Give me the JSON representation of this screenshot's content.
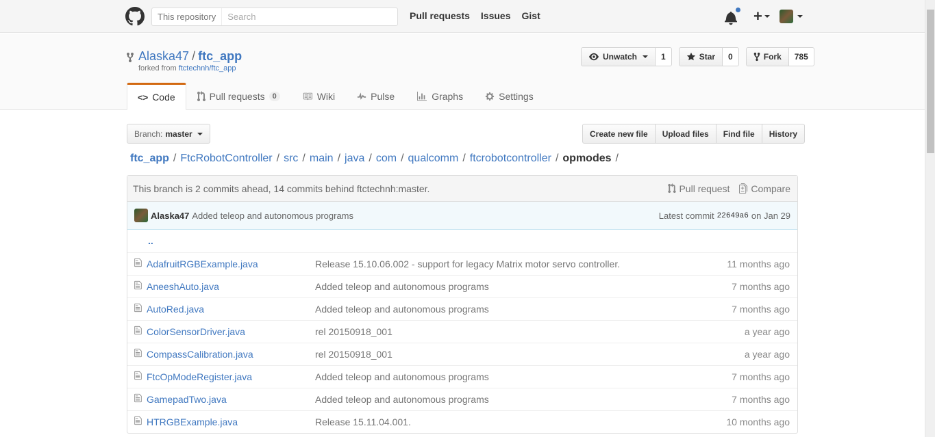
{
  "header": {
    "search_scope": "This repository",
    "search_placeholder": "Search",
    "nav": [
      "Pull requests",
      "Issues",
      "Gist"
    ]
  },
  "repo": {
    "owner": "Alaska47",
    "name": "ftc_app",
    "forked_prefix": "forked from ",
    "forked_from": "ftctechnh/ftc_app",
    "unwatch_label": "Unwatch",
    "watch_count": "1",
    "star_label": "Star",
    "star_count": "0",
    "fork_label": "Fork",
    "fork_count": "785"
  },
  "tabs": [
    {
      "label": "Code",
      "icon": "code-icon"
    },
    {
      "label": "Pull requests",
      "icon": "pull-request-icon",
      "counter": "0"
    },
    {
      "label": "Wiki",
      "icon": "book-icon"
    },
    {
      "label": "Pulse",
      "icon": "pulse-icon"
    },
    {
      "label": "Graphs",
      "icon": "graph-icon"
    },
    {
      "label": "Settings",
      "icon": "gear-icon"
    }
  ],
  "branch": {
    "label": "Branch:",
    "value": "master"
  },
  "file_actions": [
    "Create new file",
    "Upload files",
    "Find file",
    "History"
  ],
  "breadcrumb": [
    "ftc_app",
    "FtcRobotController",
    "src",
    "main",
    "java",
    "com",
    "qualcomm",
    "ftcrobotcontroller",
    "opmodes"
  ],
  "infobar": {
    "text": "This branch is 2 commits ahead, 14 commits behind ftctechnh:master.",
    "pull_request": "Pull request",
    "compare": "Compare"
  },
  "commit": {
    "author": "Alaska47",
    "message": "Added teleop and autonomous programs",
    "latest_label": "Latest commit",
    "sha": "22649a6",
    "date": "on Jan 29"
  },
  "up_tree": "..",
  "files": [
    {
      "name": "AdafruitRGBExample.java",
      "message": "Release 15.10.06.002 - support for legacy Matrix motor servo controller.",
      "age": "11 months ago"
    },
    {
      "name": "AneeshAuto.java",
      "message": "Added teleop and autonomous programs",
      "age": "7 months ago"
    },
    {
      "name": "AutoRed.java",
      "message": "Added teleop and autonomous programs",
      "age": "7 months ago"
    },
    {
      "name": "ColorSensorDriver.java",
      "message": "rel 20150918_001",
      "age": "a year ago"
    },
    {
      "name": "CompassCalibration.java",
      "message": "rel 20150918_001",
      "age": "a year ago"
    },
    {
      "name": "FtcOpModeRegister.java",
      "message": "Added teleop and autonomous programs",
      "age": "7 months ago"
    },
    {
      "name": "GamepadTwo.java",
      "message": "Added teleop and autonomous programs",
      "age": "7 months ago"
    },
    {
      "name": "HTRGBExample.java",
      "message": "Release 15.11.04.001.",
      "age": "10 months ago"
    }
  ]
}
